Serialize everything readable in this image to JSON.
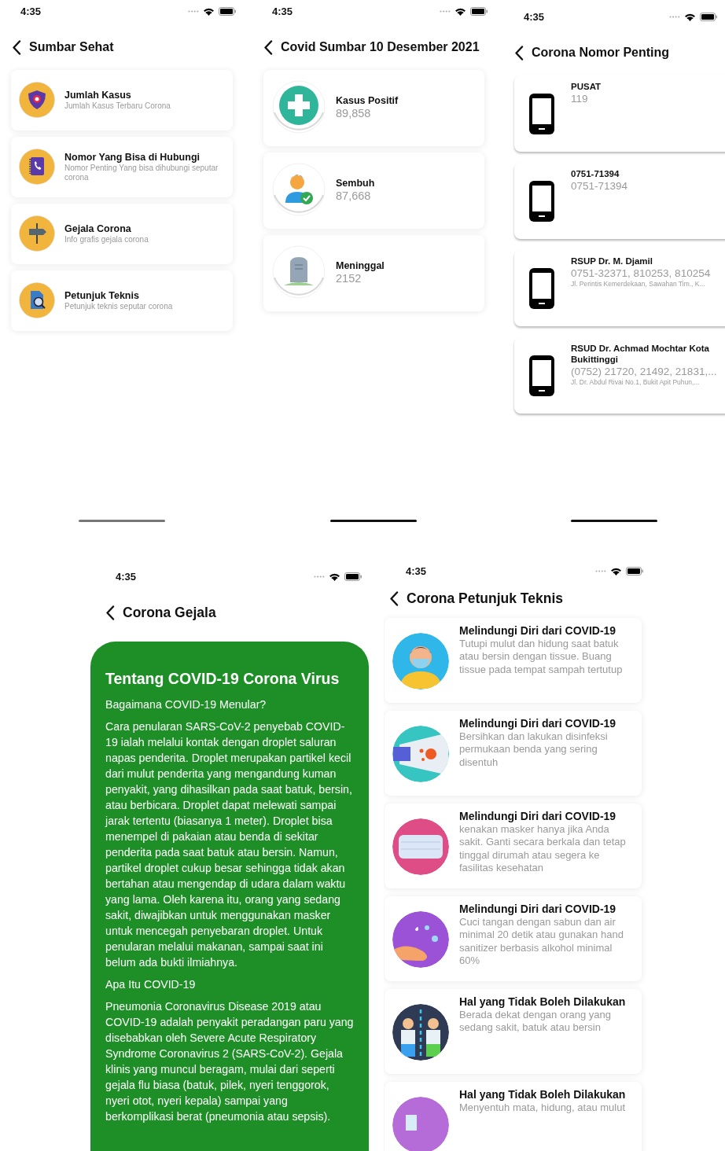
{
  "screens": [
    {
      "kind": "menu",
      "time": "4:35",
      "title": "Sumbar Sehat",
      "items": [
        {
          "kind": "shield",
          "title": "Jumlah Kasus",
          "subtitle": "Jumlah Kasus Terbaru Corona"
        },
        {
          "kind": "phonebook",
          "title": "Nomor Yang Bisa di Hubungi",
          "subtitle": "Nomor Penting Yang bisa dihubungi seputar corona"
        },
        {
          "kind": "signpost",
          "title": "Gejala Corona",
          "subtitle": "Info grafis gejala corona"
        },
        {
          "kind": "document",
          "title": "Petunjuk Teknis",
          "subtitle": "Petunjuk teknis seputar corona"
        }
      ]
    },
    {
      "kind": "stats",
      "time": "4:35",
      "title": "Covid Sumbar 10 Desember 2021",
      "items": [
        {
          "kind": "plus",
          "title": "Kasus Positif",
          "value": "89,858"
        },
        {
          "kind": "recovered",
          "title": "Sembuh",
          "value": "87,668"
        },
        {
          "kind": "grave",
          "title": "Meninggal",
          "value": "2152"
        }
      ]
    },
    {
      "kind": "contacts",
      "time": "4:35",
      "title": "Corona Nomor Penting",
      "items": [
        {
          "name": "PUSAT",
          "phone": "119"
        },
        {
          "name": "0751-71394",
          "phone": "0751-71394"
        },
        {
          "name": "RSUP Dr. M. Djamil",
          "phone": "0751-32371, 810253, 810254",
          "address": "Jl. Perintis Kemerdekaan, Sawahan Tim., K..."
        },
        {
          "name": "RSUD Dr. Achmad Mochtar Kota Bukittinggi",
          "phone": "(0752) 21720, 21492, 21831,...",
          "address": "Jl. Dr. Abdul Rivai No.1, Bukit Apit Puhun,..."
        }
      ]
    },
    {
      "kind": "article",
      "time": "4:35",
      "title": "Corona Gejala",
      "heading": "Tentang COVID-19 Corona Virus",
      "paragraphs": [
        "Bagaimana COVID-19 Menular?",
        "Cara penularan SARS-CoV-2 penyebab COVID-19 ialah melalui kontak dengan droplet saluran napas penderita. Droplet merupakan partikel kecil dari mulut penderita yang mengandung kuman penyakit, yang dihasilkan pada saat batuk, bersin, atau berbicara. Droplet dapat melewati sampai jarak tertentu (biasanya 1 meter). Droplet bisa menempel di pakaian atau benda di sekitar penderita pada saat batuk atau bersin. Namun, partikel droplet cukup besar sehingga tidak akan bertahan atau mengendap di udara dalam waktu yang lama. Oleh karena itu, orang yang sedang sakit, diwajibkan untuk menggunakan masker untuk mencegah penyebaran droplet. Untuk penularan melalui makanan, sampai saat ini belum ada bukti ilmiahnya.",
        "Apa Itu COVID-19",
        "Pneumonia Coronavirus Disease 2019 atau COVID-19 adalah penyakit peradangan paru yang disebabkan oleh Severe Acute Respiratory Syndrome Coronavirus 2 (SARS-CoV-2). Gejala klinis yang muncul beragam, mulai dari seperti gejala flu biasa (batuk, pilek, nyeri tenggorok, nyeri otot, nyeri kepala) sampai yang berkomplikasi berat (pneumonia atau sepsis)."
      ]
    },
    {
      "kind": "tips",
      "time": "4:35",
      "title": "Corona Petunjuk Teknis",
      "items": [
        {
          "kind": "mask-person",
          "title": "Melindungi Diri dari COVID-19",
          "text": "Tutupi mulut dan hidung saat batuk atau bersin dengan tissue. Buang tissue pada tempat sampah tertutup"
        },
        {
          "kind": "spray",
          "title": "Melindungi Diri dari COVID-19",
          "text": "Bersihkan dan lakukan disinfeksi permukaan benda yang sering disentuh"
        },
        {
          "kind": "mask",
          "title": "Melindungi Diri dari COVID-19",
          "text": "kenakan masker hanya jika Anda sakit. Ganti secara berkala dan tetap tinggal dirumah atau segera ke fasilitas kesehatan"
        },
        {
          "kind": "handwash",
          "title": "Melindungi Diri dari COVID-19",
          "text": "Cuci tangan dengan sabun dan air minimal 20 detik atau gunakan hand sanitizer berbasis alkohol minimal 60%"
        },
        {
          "kind": "sick-people",
          "title": "Hal yang Tidak Boleh Dilakukan",
          "text": "Berada dekat dengan orang yang sedang sakit, batuk atau bersin"
        },
        {
          "kind": "fever",
          "title": "Hal yang Tidak Boleh Dilakukan",
          "text": "Menyentuh mata, hidung, atau mulut"
        }
      ]
    }
  ]
}
